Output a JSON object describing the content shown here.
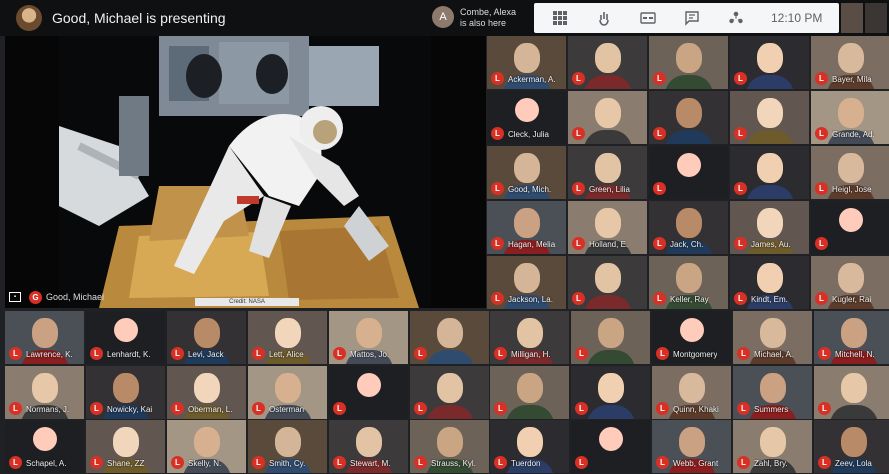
{
  "header": {
    "presenting": "Good, Michael is presenting",
    "also_here": {
      "initial": "A",
      "line1": "Combe, Alexa",
      "line2": "is also here"
    },
    "time": "12:10 PM"
  },
  "toolbar": {
    "icons": [
      "grid-view-icon",
      "raise-hand-icon",
      "captions-icon",
      "chat-icon",
      "participants-icon"
    ]
  },
  "presentation": {
    "caption": "Credit: NASA",
    "presenter_badge": "G",
    "presenter_name": "Good, Michael"
  },
  "badge_letter": "L",
  "tiles_right": [
    "Ackerman, A.",
    "",
    "",
    "",
    "Bayer, Mila",
    "Cleck, Julia",
    "",
    "",
    "",
    "Grande, Ad.",
    "Good, Mich.",
    "Green, Lilia",
    "",
    "",
    "Heigl, Jose",
    "Hagan, Melia",
    "Holland, E.",
    "Jack, Ch.",
    "James, Au.",
    "",
    "Jackson, La.",
    "",
    "Keller, Ray",
    "Kindt, Em.",
    "Kugler, Rai"
  ],
  "tiles_bottom": [
    "Lawrence, K.",
    "Lenhardt, K.",
    "Levi, Jack",
    "Lett, Alice",
    "Mattos, Jo.",
    "",
    "Milligan, H.",
    "",
    "Montgomery",
    "Michael, A.",
    "Mitchell, N.",
    "Normans, J.",
    "Nowicky, Kai",
    "Oberman, L.",
    "Osterman",
    "",
    "",
    "",
    "",
    "Quinn, Khaki",
    "Summers",
    "",
    "Schapel, A.",
    "Shane, ZZ",
    "Skelly, N.",
    "Smith, Cy.",
    "Stewart, M.",
    "Strauss, Kyl.",
    "Tuerdon",
    "",
    "Webb, Grant",
    "Zahl, Bry.",
    "Zeev, Lola"
  ]
}
